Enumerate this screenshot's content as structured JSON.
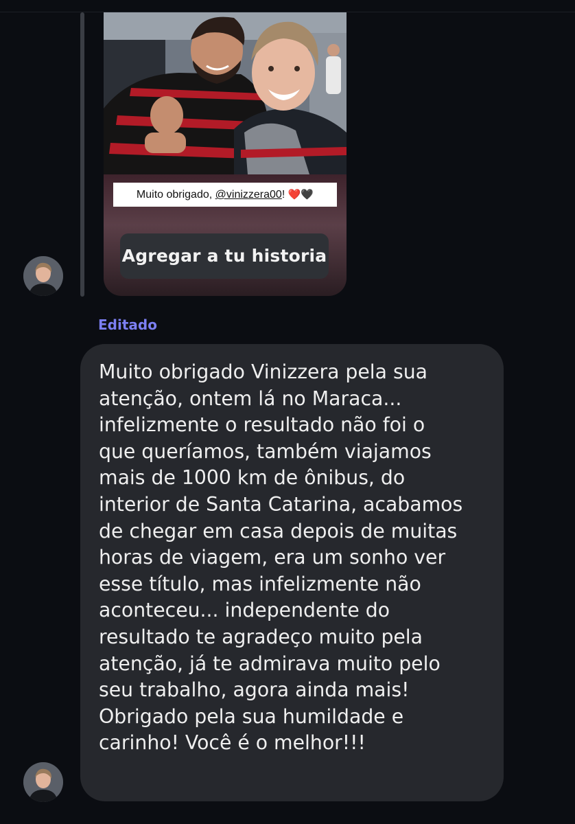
{
  "thread": {
    "story_reply": {
      "caption_text": "Muito obrigado, ",
      "caption_mention": "@vinizzera00",
      "caption_suffix": "!",
      "heart_red": "❤️",
      "heart_black": "🖤",
      "add_story_label": "Agregar a tu historia"
    },
    "edited_label": "Editado",
    "message": {
      "text": "Muito obrigado Vinizzera pela sua\natenção, ontem lá no Maraca...\ninfelizmente o resultado não foi o\nque queríamos, também viajamos\nmais de 1000 km de ônibus, do\ninterior de Santa Catarina, acabamos\nde chegar em casa depois de muitas\nhoras de viagem, era um sonho ver\nesse título, mas infelizmente não\naconteceu... independente do\nresultado te agradeço muito pela\natenção, já te admirava muito pelo\nseu trabalho, agora ainda mais!\nObrigado pela sua humildade e\ncarinho! Você é o melhor!!!"
    }
  },
  "colors": {
    "background": "#0b0d12",
    "bubble": "#26282d",
    "edited_accent": "#7c7ff2",
    "button_bg": "#2e3136"
  }
}
